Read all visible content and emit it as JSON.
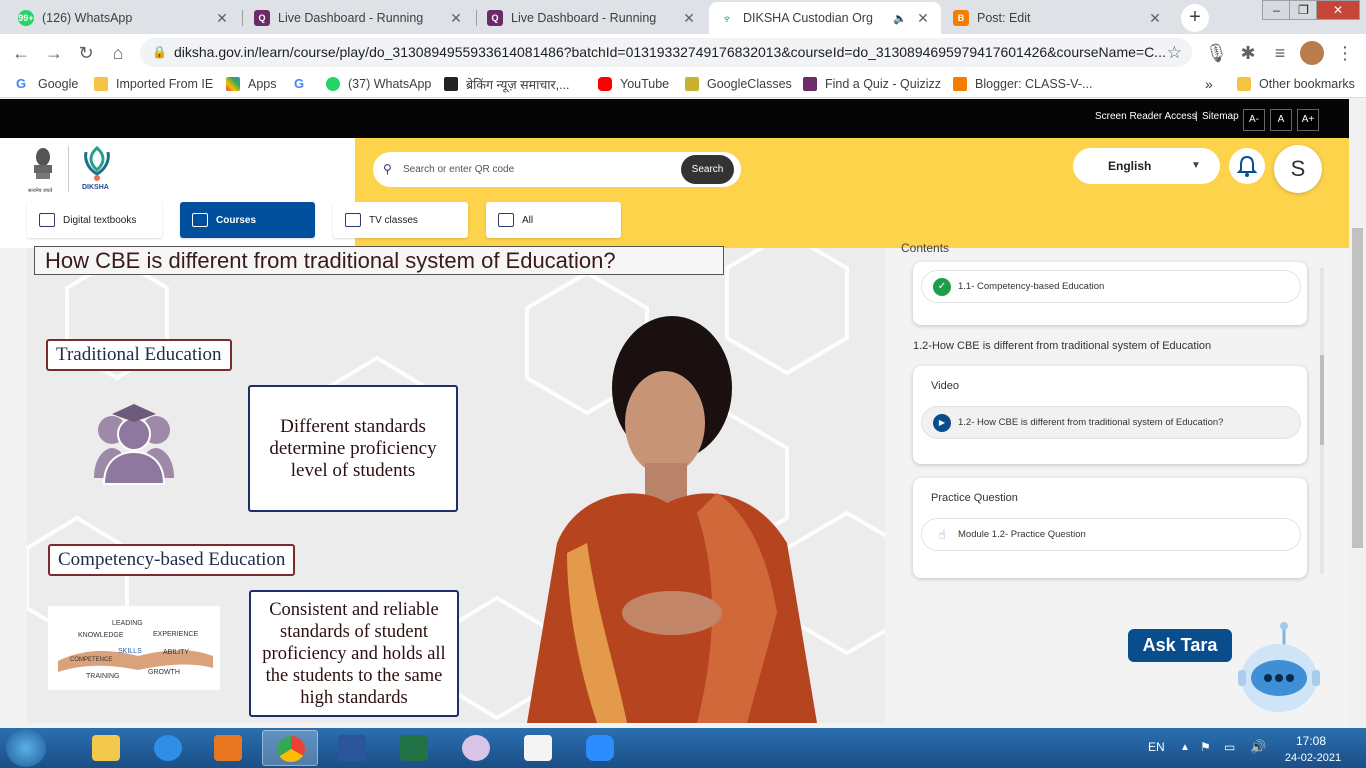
{
  "browser": {
    "tabs": [
      {
        "title": "(126) WhatsApp",
        "favicon": "whatsapp-icon",
        "active": false
      },
      {
        "title": "Live Dashboard - Running",
        "favicon": "quizizz-icon",
        "active": false
      },
      {
        "title": "Live Dashboard - Running",
        "favicon": "quizizz-icon",
        "active": false
      },
      {
        "title": "DIKSHA Custodian Org",
        "favicon": "diksha-icon",
        "active": true
      },
      {
        "title": "Post: Edit",
        "favicon": "blogger-icon",
        "active": false
      }
    ],
    "url": "diksha.gov.in/learn/course/play/do_3130894955933614081486?batchId=01319332749176832013&courseId=do_3130894695979417601426&courseName=C...",
    "bookmarks": [
      {
        "label": "Google"
      },
      {
        "label": "Imported From IE"
      },
      {
        "label": "Apps"
      },
      {
        "label": ""
      },
      {
        "label": "(37) WhatsApp"
      },
      {
        "label": "ब्रेकिंग न्यूज़ समाचार,..."
      },
      {
        "label": "YouTube"
      },
      {
        "label": "GoogleClasses"
      },
      {
        "label": "Find a Quiz - Quizizz"
      },
      {
        "label": "Blogger: CLASS-V-..."
      }
    ],
    "other_bookmarks": "Other bookmarks",
    "more_bookmarks": "»"
  },
  "site": {
    "topbar": {
      "screen_reader": "Screen Reader Access",
      "separator": "|",
      "sitemap": "Sitemap",
      "font_small": "A-",
      "font_normal": "A",
      "font_large": "A+"
    },
    "logo_label": "DIKSHA",
    "emblem_caption": "सत्यमेव जयते",
    "search": {
      "placeholder": "Search or enter QR code",
      "button": "Search"
    },
    "language": "English",
    "avatar_initial": "S",
    "categories": [
      {
        "label": "Digital textbooks",
        "active": false
      },
      {
        "label": "Courses",
        "active": true
      },
      {
        "label": "TV classes",
        "active": false
      },
      {
        "label": "All",
        "active": false
      }
    ]
  },
  "video": {
    "title": "How CBE is different from traditional system of Education?",
    "traditional_label": "Traditional Education",
    "traditional_text": "Different standards determine proficiency level of students",
    "cbe_label": "Competency-based Education",
    "cbe_text": "Consistent and reliable standards of student proficiency and holds all the students to the same high standards",
    "skills_words": [
      "LEADING",
      "KNOWLEDGE",
      "EXPERIENCE",
      "SKILLS",
      "ABILITY",
      "COMPETENCE",
      "TRAINING",
      "GROWTH"
    ]
  },
  "contents": {
    "header": "Contents",
    "completed_item": "1.1- Competency-based Education",
    "section_title": "1.2-How CBE is different from traditional system of Education",
    "video_card": {
      "label": "Video",
      "item": "1.2- How CBE is different from traditional system of Education?"
    },
    "practice_card": {
      "label": "Practice Question",
      "item": "Module 1.2- Practice Question"
    }
  },
  "assistant": {
    "label": "Ask Tara"
  },
  "taskbar": {
    "language": "EN",
    "time": "17:08",
    "date": "24-02-2021"
  },
  "colors": {
    "brand_yellow": "#fdd34c",
    "brand_blue": "#024f9d",
    "completed_green": "#1e9e4a",
    "play_blue": "#0a4d8c"
  }
}
